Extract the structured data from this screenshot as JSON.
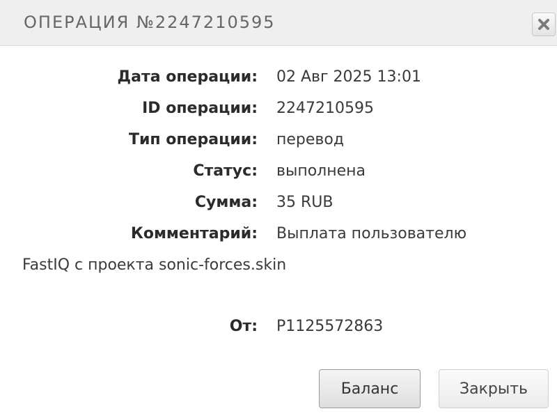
{
  "dialog": {
    "title": "ОПЕРАЦИЯ №2247210595",
    "close_icon": "close-icon"
  },
  "details": {
    "date_label": "Дата операции:",
    "date_value": "02 Авг 2025 13:01",
    "id_label": "ID операции:",
    "id_value": "2247210595",
    "type_label": "Тип операции:",
    "type_value": "перевод",
    "status_label": "Статус:",
    "status_value": "выполнена",
    "amount_label": "Сумма:",
    "amount_value": "35 RUB",
    "comment_label": "Комментарий:",
    "comment_value_line1": "Выплата пользователю",
    "comment_value_line2": "FastIQ с проекта sonic-forces.skin",
    "from_label": "От:",
    "from_value": "P1125572863"
  },
  "buttons": {
    "balance_label": "Баланс",
    "close_label": "Закрыть"
  },
  "colors": {
    "titlebar_bg": "#efefef",
    "title_text": "#666666",
    "text": "#2b2b2b"
  }
}
